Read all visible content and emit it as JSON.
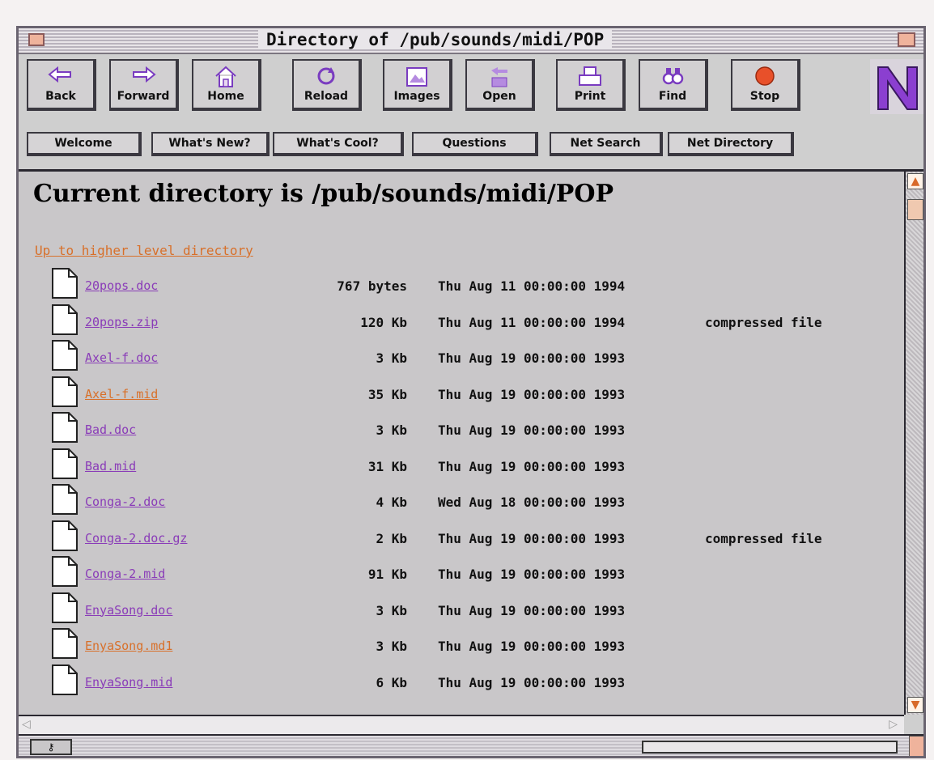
{
  "window": {
    "title": "Directory of /pub/sounds/midi/POP"
  },
  "toolbar": {
    "buttons": [
      {
        "label": "Back",
        "icon": "back-arrow-icon"
      },
      {
        "label": "Forward",
        "icon": "forward-arrow-icon"
      },
      {
        "label": "Home",
        "icon": "home-icon"
      },
      {
        "label": "Reload",
        "icon": "reload-icon"
      },
      {
        "label": "Images",
        "icon": "images-icon"
      },
      {
        "label": "Open",
        "icon": "open-icon"
      },
      {
        "label": "Print",
        "icon": "print-icon"
      },
      {
        "label": "Find",
        "icon": "find-icon"
      },
      {
        "label": "Stop",
        "icon": "stop-icon"
      }
    ],
    "logo": "netscape-n-logo"
  },
  "nav": {
    "buttons": [
      "Welcome",
      "What's New?",
      "What's Cool?",
      "Questions",
      "Net Search",
      "Net Directory"
    ]
  },
  "content": {
    "heading": "Current directory is /pub/sounds/midi/POP",
    "up_link": "Up to higher level directory",
    "files": [
      {
        "name": "20pops.doc",
        "size": "767 bytes",
        "date": "Thu Aug 11 00:00:00 1994",
        "note": ""
      },
      {
        "name": "20pops.zip",
        "size": "120 Kb",
        "date": "Thu Aug 11 00:00:00 1994",
        "note": "compressed file"
      },
      {
        "name": "Axel-f.doc",
        "size": "3 Kb",
        "date": "Thu Aug 19 00:00:00 1993",
        "note": ""
      },
      {
        "name": "Axel-f.mid",
        "size": "35 Kb",
        "date": "Thu Aug 19 00:00:00 1993",
        "note": "",
        "visited": true
      },
      {
        "name": "Bad.doc",
        "size": "3 Kb",
        "date": "Thu Aug 19 00:00:00 1993",
        "note": ""
      },
      {
        "name": "Bad.mid",
        "size": "31 Kb",
        "date": "Thu Aug 19 00:00:00 1993",
        "note": ""
      },
      {
        "name": "Conga-2.doc",
        "size": "4 Kb",
        "date": "Wed Aug 18 00:00:00 1993",
        "note": ""
      },
      {
        "name": "Conga-2.doc.gz",
        "size": "2 Kb",
        "date": "Thu Aug 19 00:00:00 1993",
        "note": "compressed file"
      },
      {
        "name": "Conga-2.mid",
        "size": "91 Kb",
        "date": "Thu Aug 19 00:00:00 1993",
        "note": ""
      },
      {
        "name": "EnyaSong.doc",
        "size": "3 Kb",
        "date": "Thu Aug 19 00:00:00 1993",
        "note": ""
      },
      {
        "name": "EnyaSong.md1",
        "size": "3 Kb",
        "date": "Thu Aug 19 00:00:00 1993",
        "note": "",
        "visited": true
      },
      {
        "name": "EnyaSong.mid",
        "size": "6 Kb",
        "date": "Thu Aug 19 00:00:00 1993",
        "note": ""
      }
    ]
  },
  "colors": {
    "link": "#8a3cb8",
    "visited_link": "#d8702a",
    "logo_purple": "#8b3fd0"
  }
}
